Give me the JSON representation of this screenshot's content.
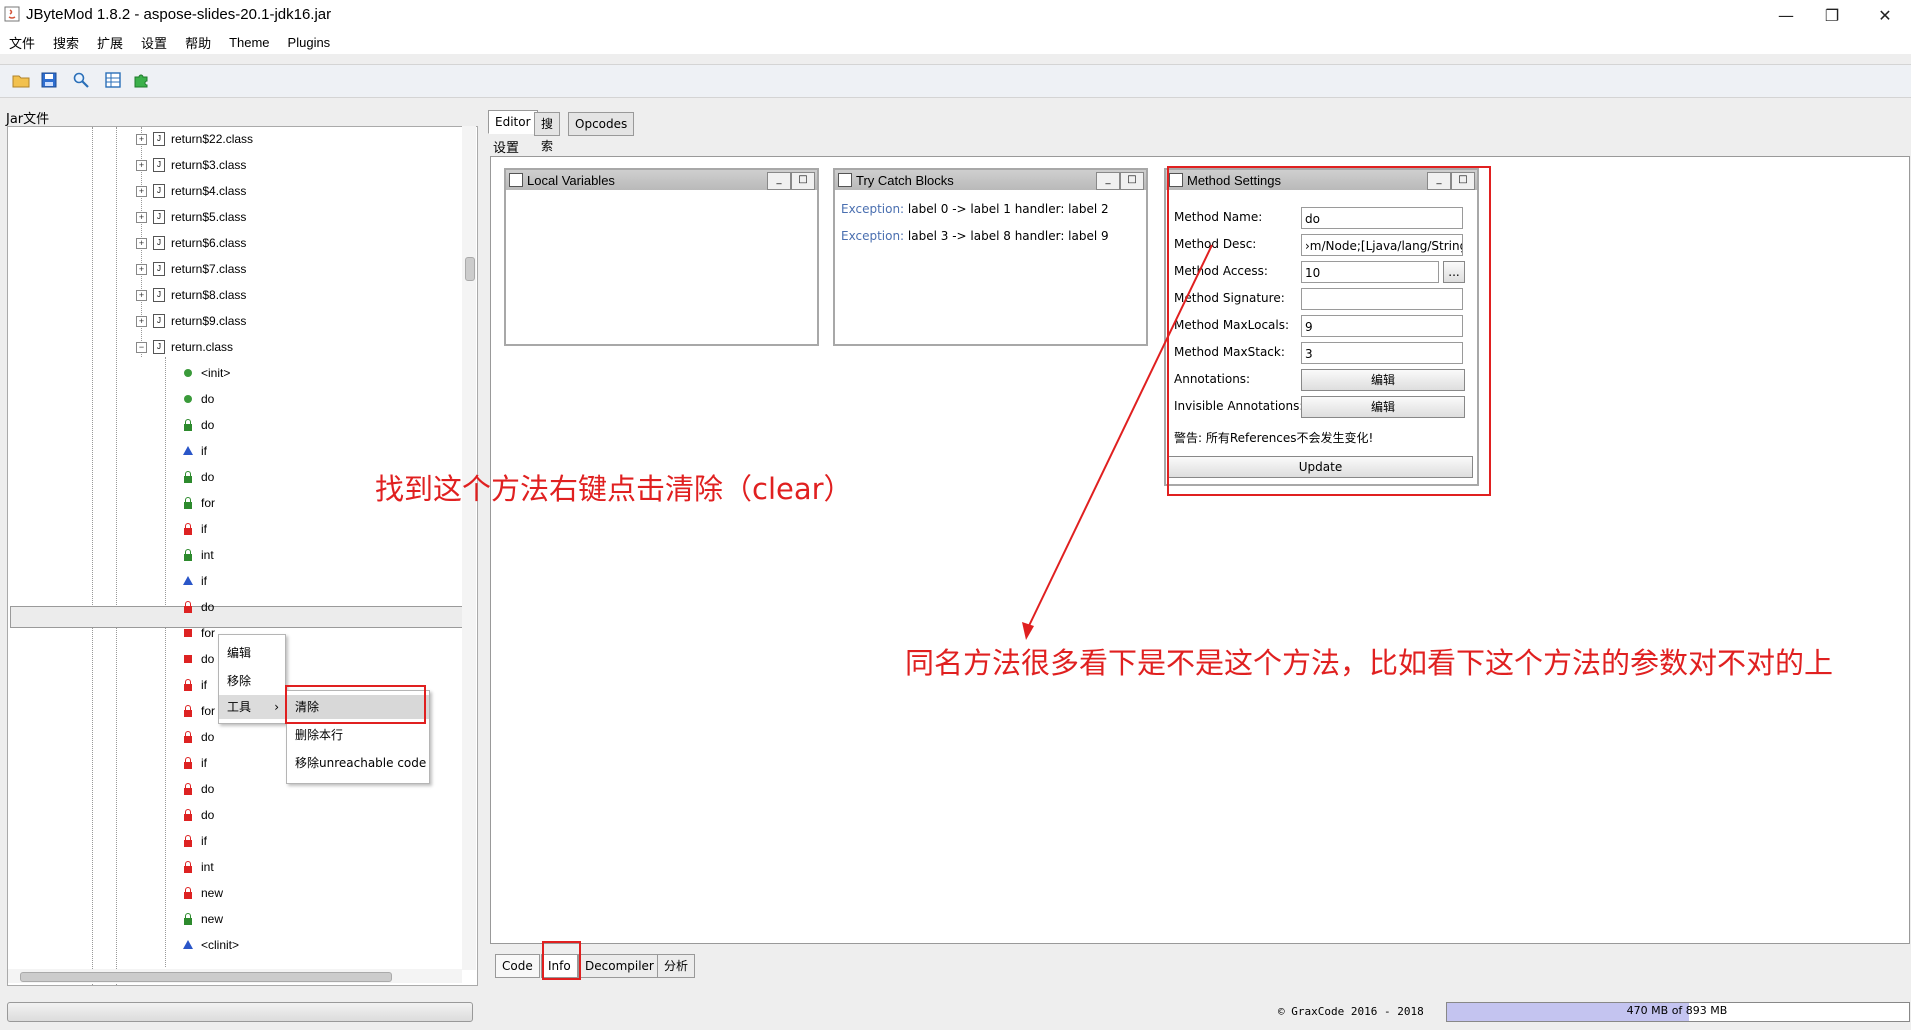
{
  "window": {
    "title": "JByteMod 1.8.2 - aspose-slides-20.1-jdk16.jar",
    "minimize_glyph": "—",
    "restore_glyph": "❐",
    "close_glyph": "✕"
  },
  "menubar": [
    "文件",
    "搜索",
    "扩展",
    "设置",
    "帮助",
    "Theme",
    "Plugins"
  ],
  "toolbar_icons": [
    "open-folder-icon",
    "save-icon",
    "search-icon",
    "table-icon",
    "puzzle-icon"
  ],
  "tree": {
    "label": "Jar文件",
    "class_items": [
      "return$22.class",
      "return$3.class",
      "return$4.class",
      "return$5.class",
      "return$6.class",
      "return$7.class",
      "return$8.class",
      "return$9.class",
      "return.class"
    ],
    "expander_collapsed": "+",
    "expander_expanded": "−",
    "file_glyph": "J",
    "methods": [
      {
        "name": "<init>",
        "icon": "dot-green"
      },
      {
        "name": "do",
        "icon": "dot-green"
      },
      {
        "name": "do",
        "icon": "lock-green"
      },
      {
        "name": "if",
        "icon": "triangle-blue"
      },
      {
        "name": "do",
        "icon": "lock-green"
      },
      {
        "name": "for",
        "icon": "lock-green"
      },
      {
        "name": "if",
        "icon": "lock-red"
      },
      {
        "name": "int",
        "icon": "lock-green"
      },
      {
        "name": "if",
        "icon": "triangle-blue"
      },
      {
        "name": "do",
        "icon": "lock-red"
      },
      {
        "name": "for",
        "icon": "square-red"
      },
      {
        "name": "do",
        "icon": "square-red"
      },
      {
        "name": "if",
        "icon": "lock-red"
      },
      {
        "name": "for",
        "icon": "lock-red"
      },
      {
        "name": "do",
        "icon": "lock-red"
      },
      {
        "name": "if",
        "icon": "lock-red"
      },
      {
        "name": "do",
        "icon": "lock-red"
      },
      {
        "name": "do",
        "icon": "lock-red"
      },
      {
        "name": "if",
        "icon": "lock-red"
      },
      {
        "name": "int",
        "icon": "lock-red"
      },
      {
        "name": "new",
        "icon": "lock-red"
      },
      {
        "name": "new",
        "icon": "lock-green"
      },
      {
        "name": "<clinit>",
        "icon": "triangle-blue"
      }
    ],
    "selected_method": "do"
  },
  "context_menu": {
    "items": [
      "编辑",
      "移除",
      "工具"
    ],
    "submenu_arrow": "›",
    "submenu": [
      "清除",
      "删除本行",
      "移除unreachable code"
    ]
  },
  "editor": {
    "tabs": [
      "Editor",
      "搜索",
      "Opcodes"
    ],
    "settings_label": "设置",
    "bottom_tabs": [
      "Code",
      "Info",
      "Decompiler",
      "分析"
    ]
  },
  "local_variables": {
    "title": "Local Variables"
  },
  "try_catch": {
    "title": "Try Catch Blocks",
    "rows": [
      {
        "exception": "Exception:",
        "text": " label 0 -> label 1 handler: label 2"
      },
      {
        "exception": "Exception:",
        "text": " label 3 -> label 8 handler: label 9"
      }
    ]
  },
  "method_settings": {
    "title": "Method Settings",
    "name_label": "Method Name:",
    "name_value": "do",
    "desc_label": "Method Desc:",
    "desc_value": "›m/Node;[Ljava/lang/String;)V",
    "access_label": "Method Access:",
    "access_value": "10",
    "access_button": "...",
    "signature_label": "Method Signature:",
    "signature_value": "",
    "maxlocals_label": "Method MaxLocals:",
    "maxlocals_value": "9",
    "maxstack_label": "Method MaxStack:",
    "maxstack_value": "3",
    "annotations_label": "Annotations:",
    "annotations_button": "编辑",
    "invisible_annotations_label": "Invisible Annotations:",
    "invisible_annotations_button": "编辑",
    "warning": "警告: 所有References不会发生变化!",
    "update_button": "Update"
  },
  "annotations": {
    "note1": "找到这个方法右键点击清除（clear）",
    "note2": "同名方法很多看下是不是这个方法，比如看下这个方法的参数对不对的上",
    "color": "#e02020"
  },
  "status": {
    "copyright": "© GraxCode 2016 - 2018",
    "memory_text": "470 MB of 893 MB",
    "memory_fraction": 0.526
  }
}
